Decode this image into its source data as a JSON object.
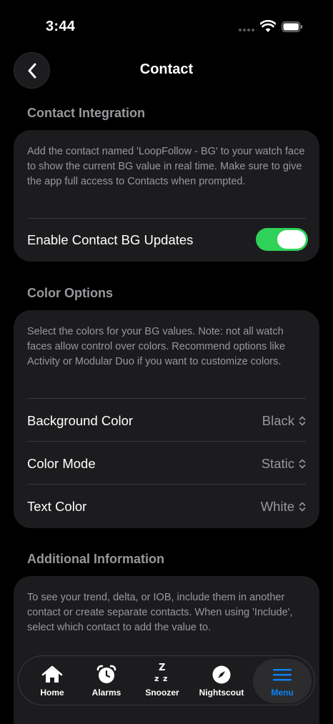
{
  "status_bar": {
    "time": "3:44"
  },
  "nav": {
    "title": "Contact"
  },
  "contact_integration": {
    "header": "Contact Integration",
    "description": "Add the contact named 'LoopFollow - BG' to your watch face to show the current BG value in real time. Make sure to give the app full access to Contacts when prompted.",
    "toggle_label": "Enable Contact BG Updates",
    "toggle_on": true
  },
  "color_options": {
    "header": "Color Options",
    "description": "Select the colors for your BG values. Note: not all watch faces allow control over colors. Recommend options like Activity or Modular Duo if you want to customize colors.",
    "rows": [
      {
        "label": "Background Color",
        "value": "Black"
      },
      {
        "label": "Color Mode",
        "value": "Static"
      },
      {
        "label": "Text Color",
        "value": "White"
      }
    ]
  },
  "additional_information": {
    "header": "Additional Information",
    "description": "To see your trend, delta, or IOB, include them in another contact or create separate contacts. When using 'Include', select which contact to add the value to."
  },
  "tab_bar": {
    "tabs": [
      {
        "label": "Home",
        "icon": "house-icon"
      },
      {
        "label": "Alarms",
        "icon": "alarm-clock-icon"
      },
      {
        "label": "Snoozer",
        "icon": "zzz-icon"
      },
      {
        "label": "Nightscout",
        "icon": "compass-icon"
      },
      {
        "label": "Menu",
        "icon": "menu-icon",
        "active": true
      }
    ]
  },
  "colors": {
    "accent": "#0a84ff",
    "toggle_on": "#30d158",
    "card": "#1c1c1e",
    "secondary_text": "#98989d"
  }
}
